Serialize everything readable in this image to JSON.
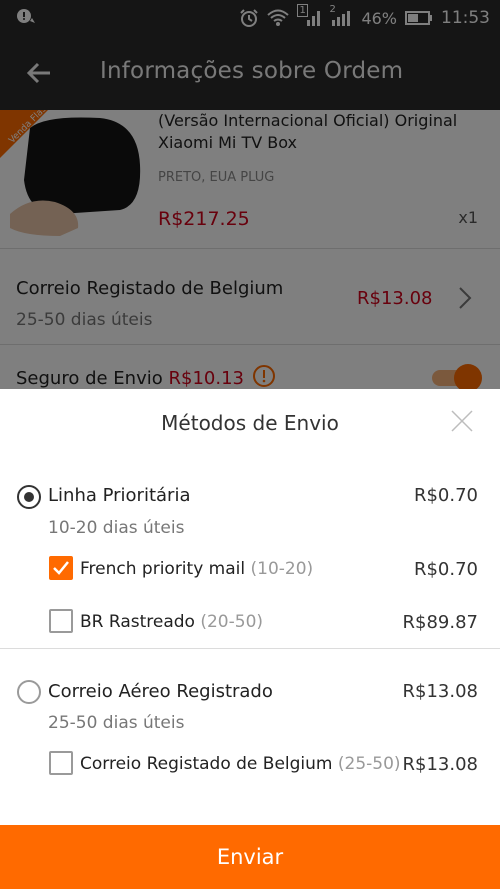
{
  "status_bar": {
    "battery": "46%",
    "time": "11:53",
    "sim1": "1",
    "sim2": "2"
  },
  "header": {
    "title": "Informações sobre Ordem"
  },
  "product": {
    "badge": "Venda Flash",
    "title": "(Versão Internacional Oficial) Original Xiaomi Mi TV Box",
    "variant": "PRETO, EUA PLUG",
    "price": "R$217.25",
    "qty": "x1"
  },
  "shipping_row": {
    "name": "Correio Registado de Belgium",
    "days": "25-50 dias úteis",
    "price": "R$13.08"
  },
  "insurance": {
    "label": "Seguro de Envio",
    "price": "R$10.13"
  },
  "sheet": {
    "title": "Métodos de Envio",
    "groups": [
      {
        "name": "Linha Prioritária",
        "days": "10-20 dias úteis",
        "price": "R$0.70",
        "selected": true,
        "options": [
          {
            "name": "French priority mail",
            "range": "(10-20)",
            "price": "R$0.70",
            "checked": true
          },
          {
            "name": "BR Rastreado",
            "range": "(20-50)",
            "price": "R$89.87",
            "checked": false
          }
        ]
      },
      {
        "name": "Correio Aéreo Registrado",
        "days": "25-50 dias úteis",
        "price": "R$13.08",
        "selected": false,
        "options": [
          {
            "name": "Correio Registado de Belgium",
            "range": "(25-50)",
            "price": "R$13.08",
            "checked": false
          }
        ]
      }
    ],
    "submit_label": "Enviar"
  },
  "colors": {
    "accent": "#ff6a00",
    "price_red": "#d0021b",
    "header_bg": "#2b2b2b"
  },
  "icons": [
    "notification-icon",
    "alarm-icon",
    "wifi-icon",
    "signal-icon",
    "battery-icon",
    "back-arrow-icon",
    "chevron-right-icon",
    "warning-icon",
    "close-icon"
  ]
}
